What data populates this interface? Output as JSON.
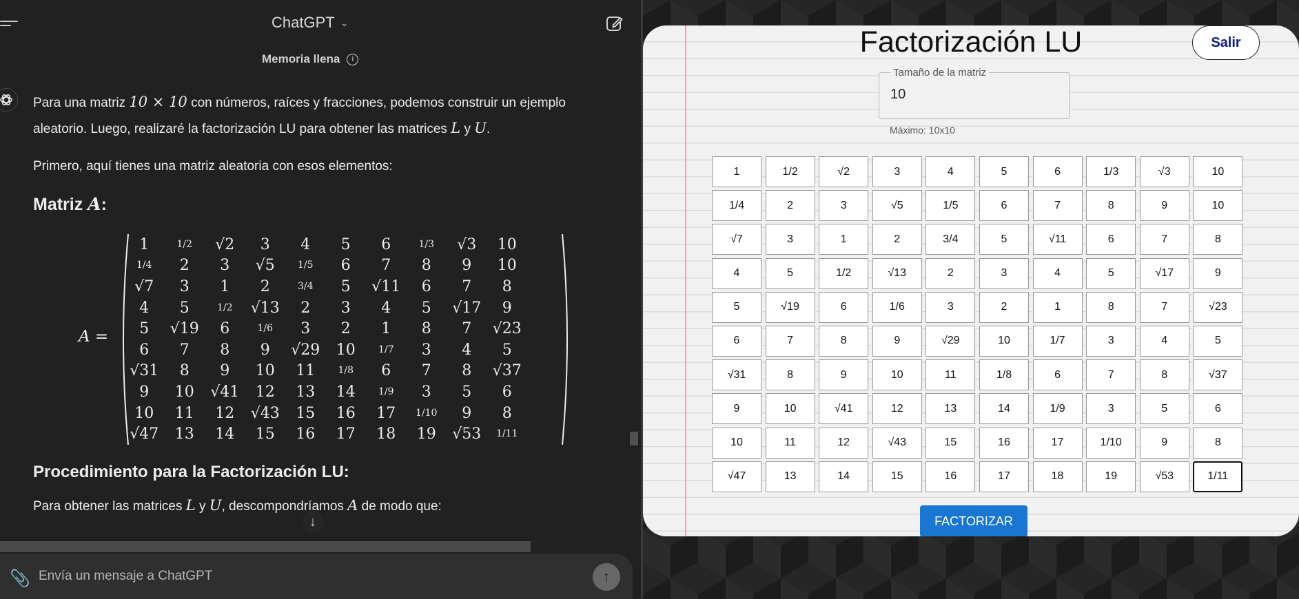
{
  "chat": {
    "title": "ChatGPT",
    "memory_label": "Memoria llena",
    "intro_prefix": "Para una matriz ",
    "intro_dim": "10 × 10",
    "intro_suffix": " con números, raíces y fracciones, podemos construir un ejemplo",
    "intro_line2_prefix": "aleatorio. Luego, realizaré la factorización LU para obtener las matrices ",
    "intro_L": "L",
    "intro_y": " y ",
    "intro_U": "U",
    "intro_end": ".",
    "first_para": "Primero, aquí tienes una matriz aleatoria con esos elementos:",
    "matrix_heading_prefix": "Matriz ",
    "matrix_heading_var": "A",
    "matrix_heading_suffix": ":",
    "matrix_lhs": "A =",
    "procedure_heading": "Procedimiento para la Factorización LU:",
    "procedure_prefix": "Para obtener las matrices ",
    "procedure_L": "L",
    "procedure_y": " y ",
    "procedure_U": "U",
    "procedure_mid": ", descompondríamos ",
    "procedure_A": "A",
    "procedure_end": " de modo que:",
    "input_placeholder": "Envía un mensaje a ChatGPT"
  },
  "matrix": [
    [
      "1",
      "1/2",
      "√2",
      "3",
      "4",
      "5",
      "6",
      "1/3",
      "√3",
      "10"
    ],
    [
      "1/4",
      "2",
      "3",
      "√5",
      "1/5",
      "6",
      "7",
      "8",
      "9",
      "10"
    ],
    [
      "√7",
      "3",
      "1",
      "2",
      "3/4",
      "5",
      "√11",
      "6",
      "7",
      "8"
    ],
    [
      "4",
      "5",
      "1/2",
      "√13",
      "2",
      "3",
      "4",
      "5",
      "√17",
      "9"
    ],
    [
      "5",
      "√19",
      "6",
      "1/6",
      "3",
      "2",
      "1",
      "8",
      "7",
      "√23"
    ],
    [
      "6",
      "7",
      "8",
      "9",
      "√29",
      "10",
      "1/7",
      "3",
      "4",
      "5"
    ],
    [
      "√31",
      "8",
      "9",
      "10",
      "11",
      "1/8",
      "6",
      "7",
      "8",
      "√37"
    ],
    [
      "9",
      "10",
      "√41",
      "12",
      "13",
      "14",
      "1/9",
      "3",
      "5",
      "6"
    ],
    [
      "10",
      "11",
      "12",
      "√43",
      "15",
      "16",
      "17",
      "1/10",
      "9",
      "8"
    ],
    [
      "√47",
      "13",
      "14",
      "15",
      "16",
      "17",
      "18",
      "19",
      "√53",
      "1/11"
    ]
  ],
  "app": {
    "title": "Factorización LU",
    "logout_label": "Salir",
    "size_legend": "Tamaño de la matriz",
    "size_value": "10",
    "max_text": "Máximo: 10x10",
    "factorize_label": "FACTORIZAR",
    "margin_color": "#f3a5a5",
    "button_color": "#1976d2"
  }
}
